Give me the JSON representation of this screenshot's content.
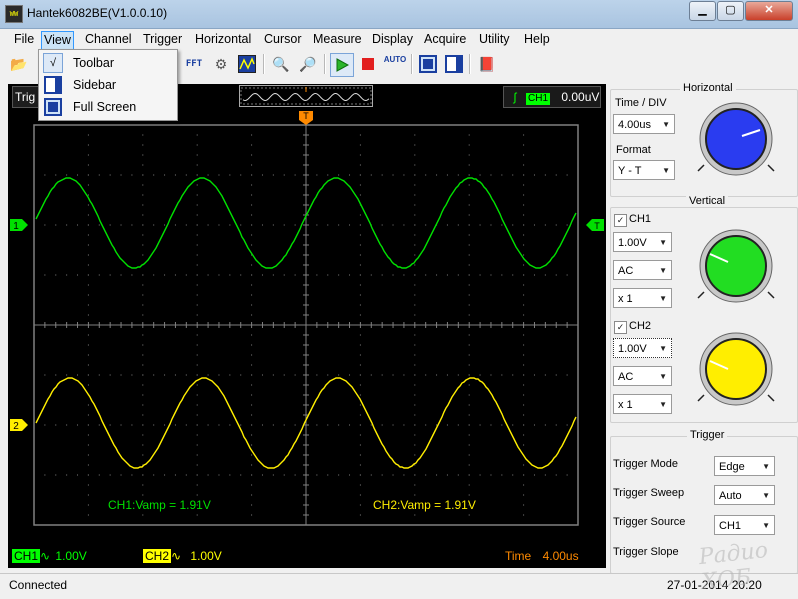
{
  "window": {
    "title": "Hantek6082BE(V1.0.0.10)",
    "icon_text": "WW",
    "min_label": "▁",
    "max_label": "▢",
    "close_label": "✕"
  },
  "menubar": [
    "File",
    "View",
    "Channel",
    "Trigger",
    "Horizontal",
    "Cursor",
    "Measure",
    "Display",
    "Acquire",
    "Utility",
    "Help"
  ],
  "view_menu": {
    "items": [
      {
        "label": "Toolbar",
        "icon": "checkmark-icon",
        "glyph": "√"
      },
      {
        "label": "Sidebar",
        "icon": "sidebar-icon",
        "glyph": ""
      },
      {
        "label": "Full Screen",
        "icon": "fullscreen-icon",
        "glyph": ""
      }
    ]
  },
  "toolbar": {
    "auto_label": "AUTO",
    "fft_label": "FFT"
  },
  "scope": {
    "trig_label": "Trig",
    "trigger_marker": "T",
    "ch1_marker": "1",
    "ch2_marker": "2",
    "trig_status": {
      "channel": "CH1",
      "level": "0.00uV"
    },
    "ch1_measure": "CH1:Vamp = 1.91V",
    "ch2_measure": "CH2:Vamp = 1.91V",
    "bottom": {
      "ch1": {
        "name": "CH1",
        "coupling": "∿",
        "value": "1.00V"
      },
      "ch2": {
        "name": "CH2",
        "coupling": "∿",
        "value": "1.00V"
      },
      "time_label": "Time",
      "time_value": "4.00us"
    },
    "colors": {
      "ch1": "#00e000",
      "ch2": "#ffee00",
      "grid": "#808080",
      "trigger": "#ff8a00"
    }
  },
  "horizontal": {
    "title": "Horizontal",
    "time_div_label": "Time / DIV",
    "time_div_value": "4.00us",
    "format_label": "Format",
    "format_value": "Y - T"
  },
  "vertical": {
    "title": "Vertical",
    "ch1": {
      "label": "CH1",
      "checked": true,
      "volts": "1.00V",
      "coupling": "AC",
      "probe": "x 1"
    },
    "ch2": {
      "label": "CH2",
      "checked": true,
      "volts": "1.00V",
      "coupling": "AC",
      "probe": "x 1"
    }
  },
  "trigger_panel": {
    "title": "Trigger",
    "mode_label": "Trigger Mode",
    "mode_value": "Edge",
    "sweep_label": "Trigger Sweep",
    "sweep_value": "Auto",
    "source_label": "Trigger Source",
    "source_value": "CH1",
    "slope_label": "Trigger Slope"
  },
  "statusbar": {
    "text": "Connected",
    "date": "27-01-2014 20:20"
  },
  "watermark": "Радио ХОБ"
}
